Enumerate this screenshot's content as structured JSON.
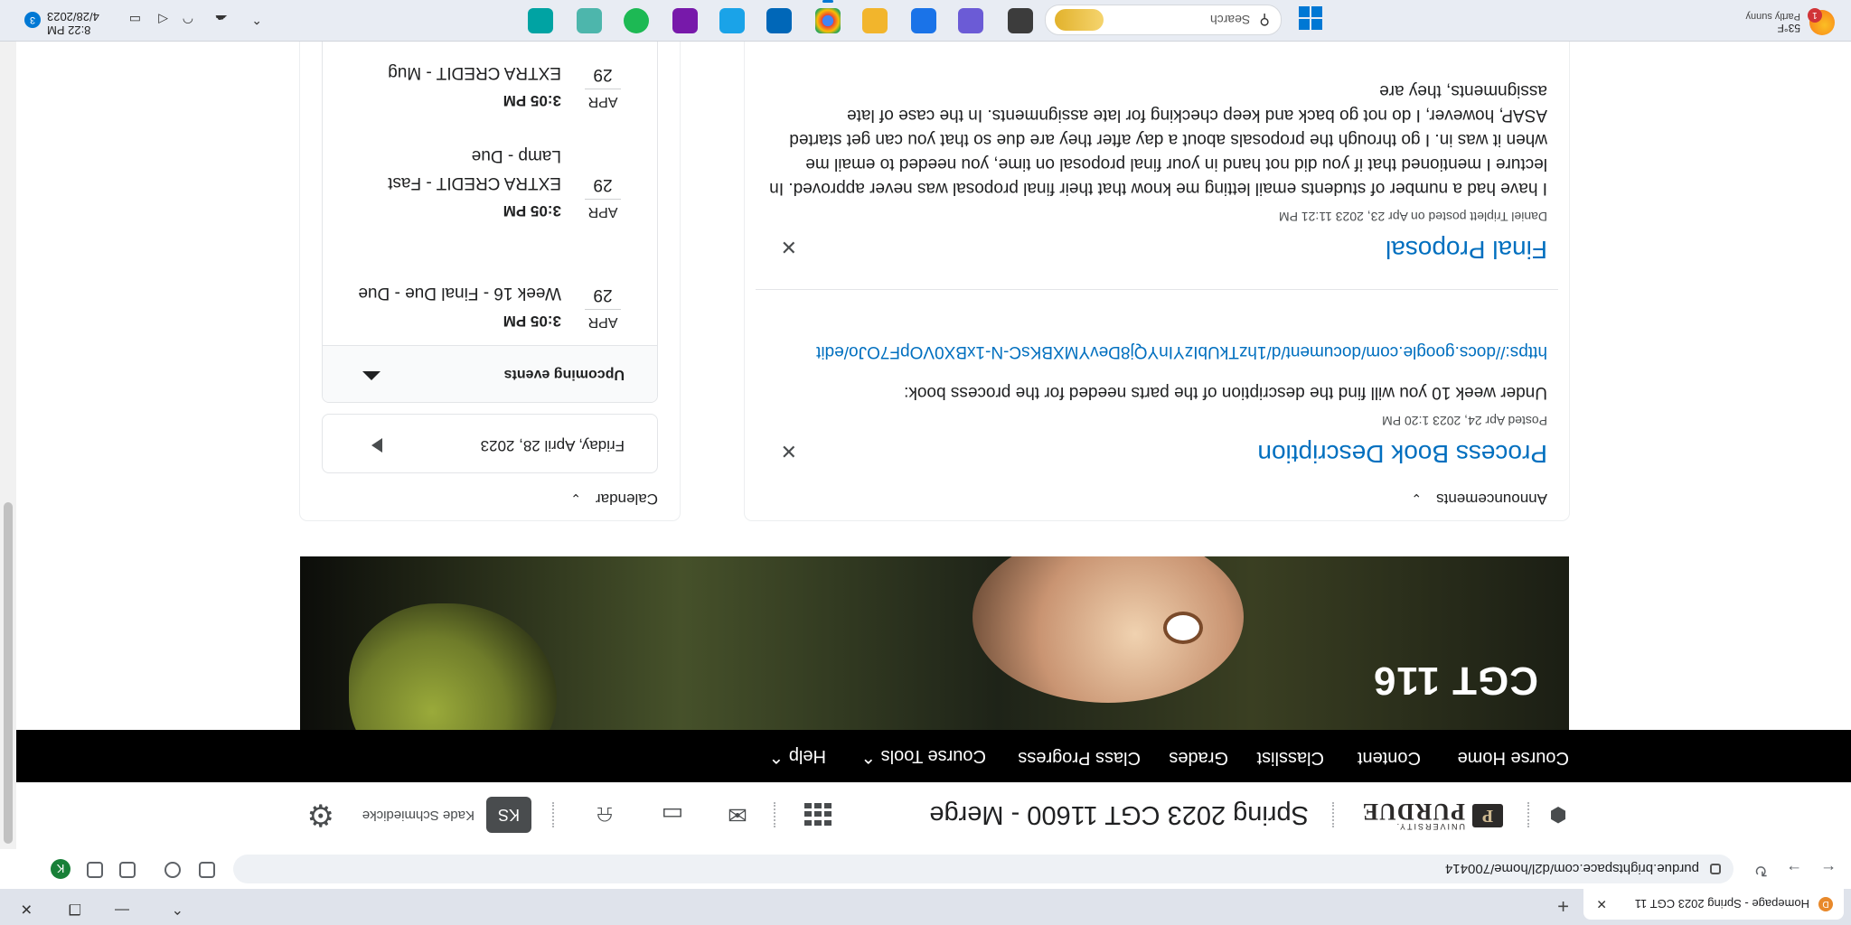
{
  "browser": {
    "tab_title": "Homepage - Spring 2023 CGT 11",
    "tab_close": "✕",
    "new_tab": "+",
    "url": "purdue.brightspace.com/d2l/home/700414",
    "profile_initial": "K"
  },
  "header": {
    "logo_university": "UNIVERSITY.",
    "logo_name": "PURDUE",
    "course_title": "Spring 2023 CGT 11600 - Merge",
    "user_initials": "KS",
    "user_name": "Kade Schmiedicke"
  },
  "nav": {
    "items": [
      {
        "label": "Course Home"
      },
      {
        "label": "Content"
      },
      {
        "label": "Classlist"
      },
      {
        "label": "Grades"
      },
      {
        "label": "Class Progress"
      },
      {
        "label": "Course Tools ⌃"
      },
      {
        "label": "Help ⌃"
      }
    ]
  },
  "banner": {
    "title": "CGT 116"
  },
  "calendar": {
    "heading": "Calendar",
    "date_label": "Friday, April 28, 2023",
    "upcoming_label": "Upcoming events",
    "events": [
      {
        "month": "APR",
        "day": "29",
        "time": "3:05 PM",
        "title": "Week 16 - Final Due - Due"
      },
      {
        "month": "APR",
        "day": "29",
        "time": "3:05 PM",
        "title": "EXTRA CREDIT - Fast Lamp - Due"
      },
      {
        "month": "APR",
        "day": "29",
        "time": "3:05 PM",
        "title": "EXTRA CREDIT - Mug"
      }
    ]
  },
  "announcements": {
    "heading": "Announcements",
    "items": [
      {
        "title": "Process Book Description",
        "meta": "Posted Apr 24, 2023 1:20 PM",
        "body": "Under week 10 you will find the description of the parts needed for the process book:",
        "link": "https://docs.google.com/document/d/1hzTkUbIzYInYQj8DevYMXBKsC-N-1xBX0VOpF7OJo/edit"
      },
      {
        "title": "Final Proposal",
        "meta": "Daniel Triplett posted on Apr 23, 2023 11:21 PM",
        "body": "I have had a number of students email letting me know that their final proposal was never approved. In lecture I mentioned that if you did not hand in your final proposal on time, you needed to email me when it was in. I go through the proposals about a day after they are due so that you can get started ASAP, however, I do not go back and keep checking for late assignments. In the case of late assignments, they are"
      }
    ]
  },
  "taskbar": {
    "weather_temp": "53°F",
    "weather_desc": "Partly sunny",
    "weather_badge": "1",
    "search_label": "Search",
    "time": "8:22 PM",
    "date": "4/28/2023",
    "notif_count": "3"
  },
  "colors": {
    "link": "#006fbf",
    "nav_bg": "#000000",
    "avatar_bg": "#494c4e"
  }
}
